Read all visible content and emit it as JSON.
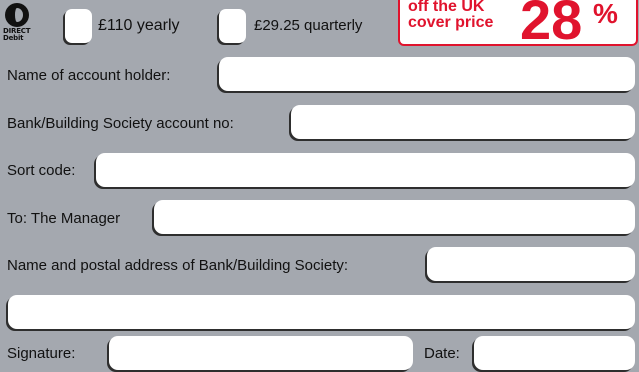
{
  "logo": {
    "line1": "DIRECT",
    "line2": "Debit"
  },
  "options": [
    {
      "label": "£110 yearly"
    },
    {
      "label": "£29.25 quarterly"
    }
  ],
  "offer": {
    "line1": "off the UK",
    "line2": "cover price",
    "percent": "28",
    "sign": "%"
  },
  "fields": {
    "account_holder": {
      "label": "Name of account holder:",
      "value": ""
    },
    "account_no": {
      "label": "Bank/Building Society account no:",
      "value": ""
    },
    "sort_code": {
      "label": "Sort code:",
      "value": ""
    },
    "to_manager": {
      "label": "To: The Manager",
      "value": ""
    },
    "bank_address": {
      "label": "Name and postal address of Bank/Building Society:",
      "value": ""
    },
    "address_line2": {
      "value": ""
    },
    "signature": {
      "label": "Signature:",
      "value": ""
    },
    "date": {
      "label": "Date:",
      "value": ""
    }
  }
}
